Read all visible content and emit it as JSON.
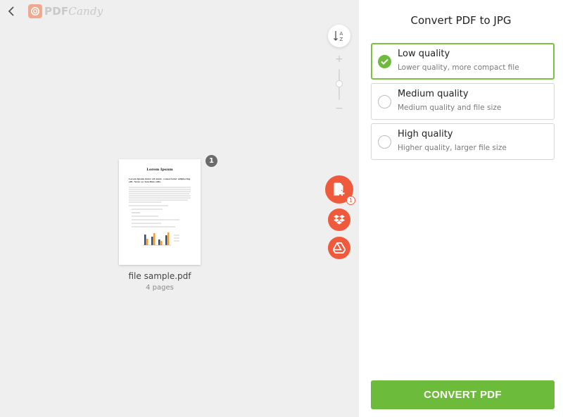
{
  "app": {
    "logo_pdf": "PDF",
    "logo_candy": "Candy"
  },
  "file": {
    "name": "file sample.pdf",
    "pages": "4 pages",
    "index_badge": "1",
    "thumbnail": {
      "title": "Lorem Ipsum",
      "subtitle": "Lorem ipsum dolor sit amet, consectetur adipiscing elit. Nunc ac faucibus odio."
    }
  },
  "tools": {
    "add_file_count": "1"
  },
  "panel": {
    "title": "Convert PDF to JPG",
    "options": [
      {
        "title": "Low quality",
        "subtitle": "Lower quality, more compact file",
        "selected": true
      },
      {
        "title": "Medium quality",
        "subtitle": "Medium quality and file size",
        "selected": false
      },
      {
        "title": "High quality",
        "subtitle": "Higher quality, larger file size",
        "selected": false
      }
    ],
    "convert_label": "CONVERT PDF"
  },
  "colors": {
    "accent_green": "#6dbb3a",
    "action_red": "#f05a3c",
    "logo_pink": "#f0a98f"
  },
  "icons": [
    "back-icon",
    "candy-logo-icon",
    "sort-az-icon",
    "zoom-plus-icon",
    "zoom-minus-icon",
    "add-file-icon",
    "dropbox-icon",
    "google-drive-icon",
    "checkmark-icon"
  ]
}
